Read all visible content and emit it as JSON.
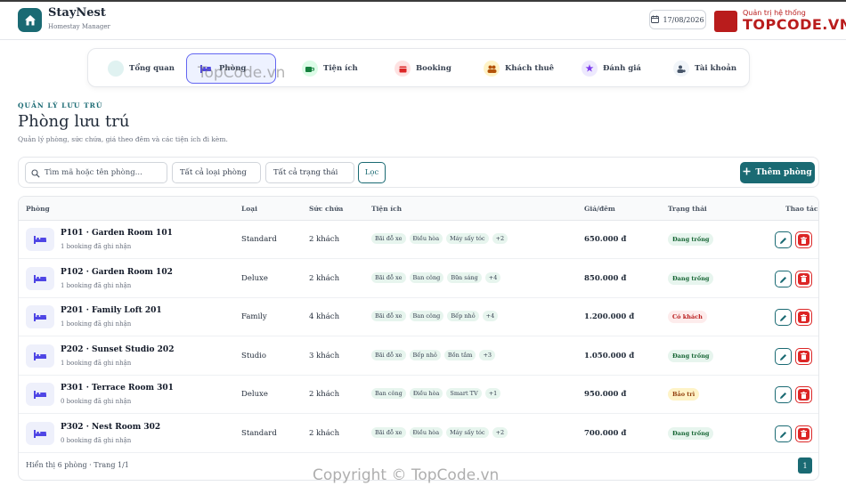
{
  "app": {
    "name": "StayNest",
    "subtitle": "Homestay Manager",
    "date": "17/08/2026",
    "watermark_logo_sub": "Quản trị hệ thống",
    "watermark_logo_text": "TOPCODE.VN",
    "watermark_center": "TopCode.vn",
    "watermark_bottom": "Copyright © TopCode.vn"
  },
  "nav": [
    {
      "label": "Tổng quan",
      "icon": "dashboard-icon",
      "color": "#e0f2f1"
    },
    {
      "label": "Phòng",
      "icon": "bed-icon",
      "color": "#eef2ff",
      "active": true
    },
    {
      "label": "Tiện ích",
      "icon": "coffee-icon",
      "color": "#dcfce7"
    },
    {
      "label": "Booking",
      "icon": "calendar-icon",
      "color": "#fee2e2"
    },
    {
      "label": "Khách thuê",
      "icon": "users-icon",
      "color": "#fef3c7"
    },
    {
      "label": "Đánh giá",
      "icon": "star-icon",
      "color": "#ede9fe"
    },
    {
      "label": "Tài khoản",
      "icon": "user-gear-icon",
      "color": "#f1f5f9"
    }
  ],
  "page": {
    "eyebrow": "QUẢN LÝ LƯU TRÚ",
    "title": "Phòng lưu trú",
    "subtitle": "Quản lý phòng, sức chứa, giá theo đêm và các tiện ích đi kèm."
  },
  "filters": {
    "search_placeholder": "Tìm mã hoặc tên phòng...",
    "type_select": "Tất cả loại phòng",
    "status_select": "Tất cả trạng thái",
    "filter_button": "Lọc",
    "add_button": "Thêm phòng"
  },
  "table": {
    "headers": {
      "room": "Phòng",
      "type": "Loại",
      "capacity": "Sức chứa",
      "amenities": "Tiện ích",
      "price": "Giá/đêm",
      "status": "Trạng thái",
      "actions": "Thao tác"
    },
    "rows": [
      {
        "name": "P101 · Garden Room 101",
        "sub": "1 booking đã ghi nhận",
        "type": "Standard",
        "capacity": "2 khách",
        "amenities": [
          "Bãi đỗ xe",
          "Điều hòa",
          "Máy sấy tóc"
        ],
        "more": "+2",
        "price": "650.000 đ",
        "status": "Đang trống",
        "status_color": "#166534",
        "status_bg": "#e7f5ee"
      },
      {
        "name": "P102 · Garden Room 102",
        "sub": "1 booking đã ghi nhận",
        "type": "Deluxe",
        "capacity": "2 khách",
        "amenities": [
          "Bãi đỗ xe",
          "Ban công",
          "Bữa sáng"
        ],
        "more": "+4",
        "price": "850.000 đ",
        "status": "Đang trống",
        "status_color": "#166534",
        "status_bg": "#e7f5ee"
      },
      {
        "name": "P201 · Family Loft 201",
        "sub": "1 booking đã ghi nhận",
        "type": "Family",
        "capacity": "4 khách",
        "amenities": [
          "Bãi đỗ xe",
          "Ban công",
          "Bếp nhỏ"
        ],
        "more": "+4",
        "price": "1.200.000 đ",
        "status": "Có khách",
        "status_color": "#b91c1c",
        "status_bg": "#fdecec"
      },
      {
        "name": "P202 · Sunset Studio 202",
        "sub": "1 booking đã ghi nhận",
        "type": "Studio",
        "capacity": "3 khách",
        "amenities": [
          "Bãi đỗ xe",
          "Bếp nhỏ",
          "Bồn tắm"
        ],
        "more": "+3",
        "price": "1.050.000 đ",
        "status": "Đang trống",
        "status_color": "#166534",
        "status_bg": "#e7f5ee"
      },
      {
        "name": "P301 · Terrace Room 301",
        "sub": "0 booking đã ghi nhận",
        "type": "Deluxe",
        "capacity": "2 khách",
        "amenities": [
          "Ban công",
          "Điều hòa",
          "Smart TV"
        ],
        "more": "+1",
        "price": "950.000 đ",
        "status": "Bảo trì",
        "status_color": "#92400e",
        "status_bg": "#fef3c7"
      },
      {
        "name": "P302 · Nest Room 302",
        "sub": "0 booking đã ghi nhận",
        "type": "Standard",
        "capacity": "2 khách",
        "amenities": [
          "Bãi đỗ xe",
          "Điều hòa",
          "Máy sấy tóc"
        ],
        "more": "+2",
        "price": "700.000 đ",
        "status": "Đang trống",
        "status_color": "#166534",
        "status_bg": "#e7f5ee"
      }
    ],
    "footer": "Hiển thị 6 phòng · Trang 1/1",
    "page_number": "1"
  }
}
